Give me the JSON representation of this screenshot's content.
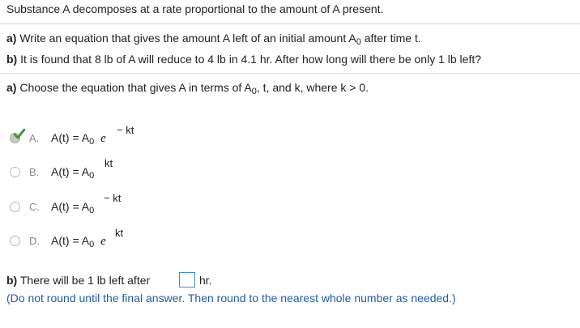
{
  "intro": "Substance A decomposes at a rate proportional to the amount of A present.",
  "part_a_label": "a)",
  "part_a_text_1": "Write an equation that gives the amount A left of an initial amount A",
  "part_a_sub": "0",
  "part_a_text_2": "after time t.",
  "part_b_label": "b)",
  "part_b_text": "It is found that 8 lb of A will reduce to 4 lb in 4.1 hr. After how long will there be only 1 lb left?",
  "question_a_label": "a)",
  "question_a_text_1": "Choose the equation that gives A in terms of A",
  "question_a_sub": "0",
  "question_a_text_2": ", t, and k, where k > 0.",
  "options": [
    {
      "letter": "A.",
      "lhs": "A(t) = A",
      "sub": "0",
      "e": "e",
      "exp": "− kt",
      "selected": true
    },
    {
      "letter": "B.",
      "lhs": "A(t) = A",
      "sub": "0",
      "e": "",
      "exp": "kt",
      "selected": false
    },
    {
      "letter": "C.",
      "lhs": "A(t) = A",
      "sub": "0",
      "e": "",
      "exp": "− kt",
      "selected": false
    },
    {
      "letter": "D.",
      "lhs": "A(t) = A",
      "sub": "0",
      "e": "e",
      "exp": "kt",
      "selected": false
    }
  ],
  "question_b_label": "b)",
  "question_b_text": "There will be 1 lb left after",
  "question_b_value": "",
  "question_b_unit": "hr.",
  "instruction": "(Do not round until the final answer. Then round to the nearest whole number as needed.)",
  "colors": {
    "check": "#3c9a2e",
    "note": "#1f5fa6",
    "box_border": "#3d8ed6"
  },
  "icons": {
    "correct": "check-icon"
  }
}
